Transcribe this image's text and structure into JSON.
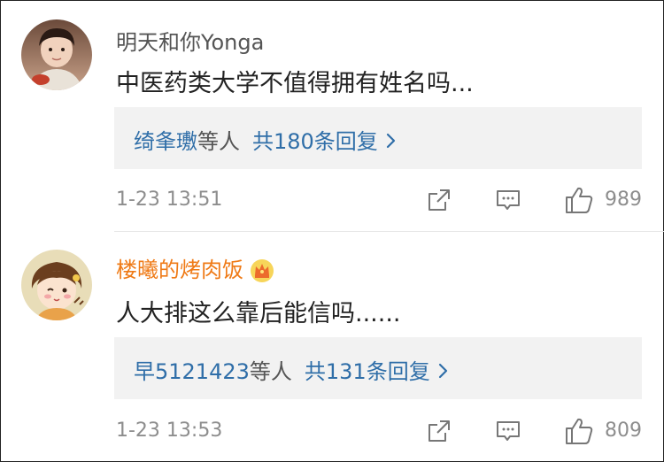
{
  "comments": [
    {
      "username": "明天和你Yonga",
      "vip": false,
      "content": "中医药类大学不值得拥有姓名吗...",
      "reply_preview": {
        "names": "绮夆璷",
        "suffix": "等人",
        "count_text": "共180条回复"
      },
      "timestamp": "1-23 13:51",
      "likes": "989",
      "icons": [
        "share-icon",
        "comment-icon",
        "like-icon"
      ]
    },
    {
      "username": "楼曦的烤肉饭",
      "vip": true,
      "content": "人大排这么靠后能信吗......",
      "reply_preview": {
        "names": "早5121423",
        "suffix": "等人",
        "count_text": "共131条回复"
      },
      "timestamp": "1-23 13:53",
      "likes": "809",
      "icons": [
        "share-icon",
        "comment-icon",
        "like-icon"
      ]
    }
  ],
  "colors": {
    "link": "#2f6ea8",
    "vip_name": "#ef7a16",
    "meta": "#8d8d8d",
    "reply_bg": "#f2f2f2"
  }
}
